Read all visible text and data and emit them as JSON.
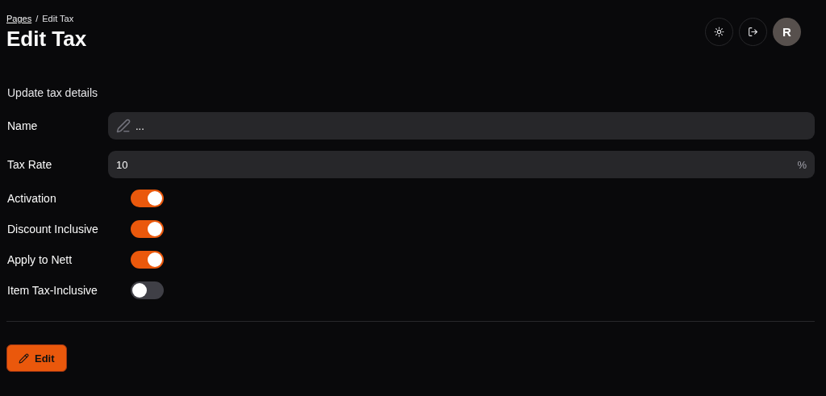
{
  "breadcrumb": {
    "items": [
      "Pages",
      "Edit Tax"
    ],
    "separator": "/"
  },
  "title": "Edit Tax",
  "header_actions": {
    "avatar": "R"
  },
  "form": {
    "heading": "Update tax details",
    "fields": [
      {
        "label": "Name",
        "value": "...",
        "kind": "text"
      },
      {
        "label": "Tax Rate",
        "value": "10",
        "suffix": "%",
        "kind": "number"
      }
    ],
    "toggles": [
      {
        "label": "Activation",
        "on": true
      },
      {
        "label": "Discount Inclusive",
        "on": true
      },
      {
        "label": "Apply to Nett",
        "on": true
      },
      {
        "label": "Item Tax-Inclusive",
        "on": false
      }
    ]
  },
  "submit_button": "Edit"
}
